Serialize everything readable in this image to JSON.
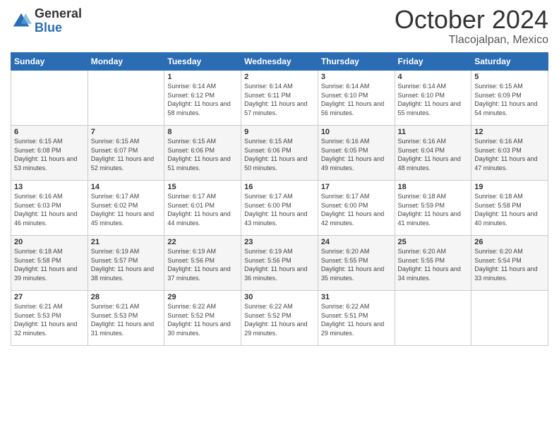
{
  "logo": {
    "general": "General",
    "blue": "Blue"
  },
  "header": {
    "month": "October 2024",
    "location": "Tlacojalpan, Mexico"
  },
  "weekdays": [
    "Sunday",
    "Monday",
    "Tuesday",
    "Wednesday",
    "Thursday",
    "Friday",
    "Saturday"
  ],
  "weeks": [
    [
      {
        "day": "",
        "info": ""
      },
      {
        "day": "",
        "info": ""
      },
      {
        "day": "1",
        "info": "Sunrise: 6:14 AM\nSunset: 6:12 PM\nDaylight: 11 hours and 58 minutes."
      },
      {
        "day": "2",
        "info": "Sunrise: 6:14 AM\nSunset: 6:11 PM\nDaylight: 11 hours and 57 minutes."
      },
      {
        "day": "3",
        "info": "Sunrise: 6:14 AM\nSunset: 6:10 PM\nDaylight: 11 hours and 56 minutes."
      },
      {
        "day": "4",
        "info": "Sunrise: 6:14 AM\nSunset: 6:10 PM\nDaylight: 11 hours and 55 minutes."
      },
      {
        "day": "5",
        "info": "Sunrise: 6:15 AM\nSunset: 6:09 PM\nDaylight: 11 hours and 54 minutes."
      }
    ],
    [
      {
        "day": "6",
        "info": "Sunrise: 6:15 AM\nSunset: 6:08 PM\nDaylight: 11 hours and 53 minutes."
      },
      {
        "day": "7",
        "info": "Sunrise: 6:15 AM\nSunset: 6:07 PM\nDaylight: 11 hours and 52 minutes."
      },
      {
        "day": "8",
        "info": "Sunrise: 6:15 AM\nSunset: 6:06 PM\nDaylight: 11 hours and 51 minutes."
      },
      {
        "day": "9",
        "info": "Sunrise: 6:15 AM\nSunset: 6:06 PM\nDaylight: 11 hours and 50 minutes."
      },
      {
        "day": "10",
        "info": "Sunrise: 6:16 AM\nSunset: 6:05 PM\nDaylight: 11 hours and 49 minutes."
      },
      {
        "day": "11",
        "info": "Sunrise: 6:16 AM\nSunset: 6:04 PM\nDaylight: 11 hours and 48 minutes."
      },
      {
        "day": "12",
        "info": "Sunrise: 6:16 AM\nSunset: 6:03 PM\nDaylight: 11 hours and 47 minutes."
      }
    ],
    [
      {
        "day": "13",
        "info": "Sunrise: 6:16 AM\nSunset: 6:03 PM\nDaylight: 11 hours and 46 minutes."
      },
      {
        "day": "14",
        "info": "Sunrise: 6:17 AM\nSunset: 6:02 PM\nDaylight: 11 hours and 45 minutes."
      },
      {
        "day": "15",
        "info": "Sunrise: 6:17 AM\nSunset: 6:01 PM\nDaylight: 11 hours and 44 minutes."
      },
      {
        "day": "16",
        "info": "Sunrise: 6:17 AM\nSunset: 6:00 PM\nDaylight: 11 hours and 43 minutes."
      },
      {
        "day": "17",
        "info": "Sunrise: 6:17 AM\nSunset: 6:00 PM\nDaylight: 11 hours and 42 minutes."
      },
      {
        "day": "18",
        "info": "Sunrise: 6:18 AM\nSunset: 5:59 PM\nDaylight: 11 hours and 41 minutes."
      },
      {
        "day": "19",
        "info": "Sunrise: 6:18 AM\nSunset: 5:58 PM\nDaylight: 11 hours and 40 minutes."
      }
    ],
    [
      {
        "day": "20",
        "info": "Sunrise: 6:18 AM\nSunset: 5:58 PM\nDaylight: 11 hours and 39 minutes."
      },
      {
        "day": "21",
        "info": "Sunrise: 6:19 AM\nSunset: 5:57 PM\nDaylight: 11 hours and 38 minutes."
      },
      {
        "day": "22",
        "info": "Sunrise: 6:19 AM\nSunset: 5:56 PM\nDaylight: 11 hours and 37 minutes."
      },
      {
        "day": "23",
        "info": "Sunrise: 6:19 AM\nSunset: 5:56 PM\nDaylight: 11 hours and 36 minutes."
      },
      {
        "day": "24",
        "info": "Sunrise: 6:20 AM\nSunset: 5:55 PM\nDaylight: 11 hours and 35 minutes."
      },
      {
        "day": "25",
        "info": "Sunrise: 6:20 AM\nSunset: 5:55 PM\nDaylight: 11 hours and 34 minutes."
      },
      {
        "day": "26",
        "info": "Sunrise: 6:20 AM\nSunset: 5:54 PM\nDaylight: 11 hours and 33 minutes."
      }
    ],
    [
      {
        "day": "27",
        "info": "Sunrise: 6:21 AM\nSunset: 5:53 PM\nDaylight: 11 hours and 32 minutes."
      },
      {
        "day": "28",
        "info": "Sunrise: 6:21 AM\nSunset: 5:53 PM\nDaylight: 11 hours and 31 minutes."
      },
      {
        "day": "29",
        "info": "Sunrise: 6:22 AM\nSunset: 5:52 PM\nDaylight: 11 hours and 30 minutes."
      },
      {
        "day": "30",
        "info": "Sunrise: 6:22 AM\nSunset: 5:52 PM\nDaylight: 11 hours and 29 minutes."
      },
      {
        "day": "31",
        "info": "Sunrise: 6:22 AM\nSunset: 5:51 PM\nDaylight: 11 hours and 29 minutes."
      },
      {
        "day": "",
        "info": ""
      },
      {
        "day": "",
        "info": ""
      }
    ]
  ]
}
